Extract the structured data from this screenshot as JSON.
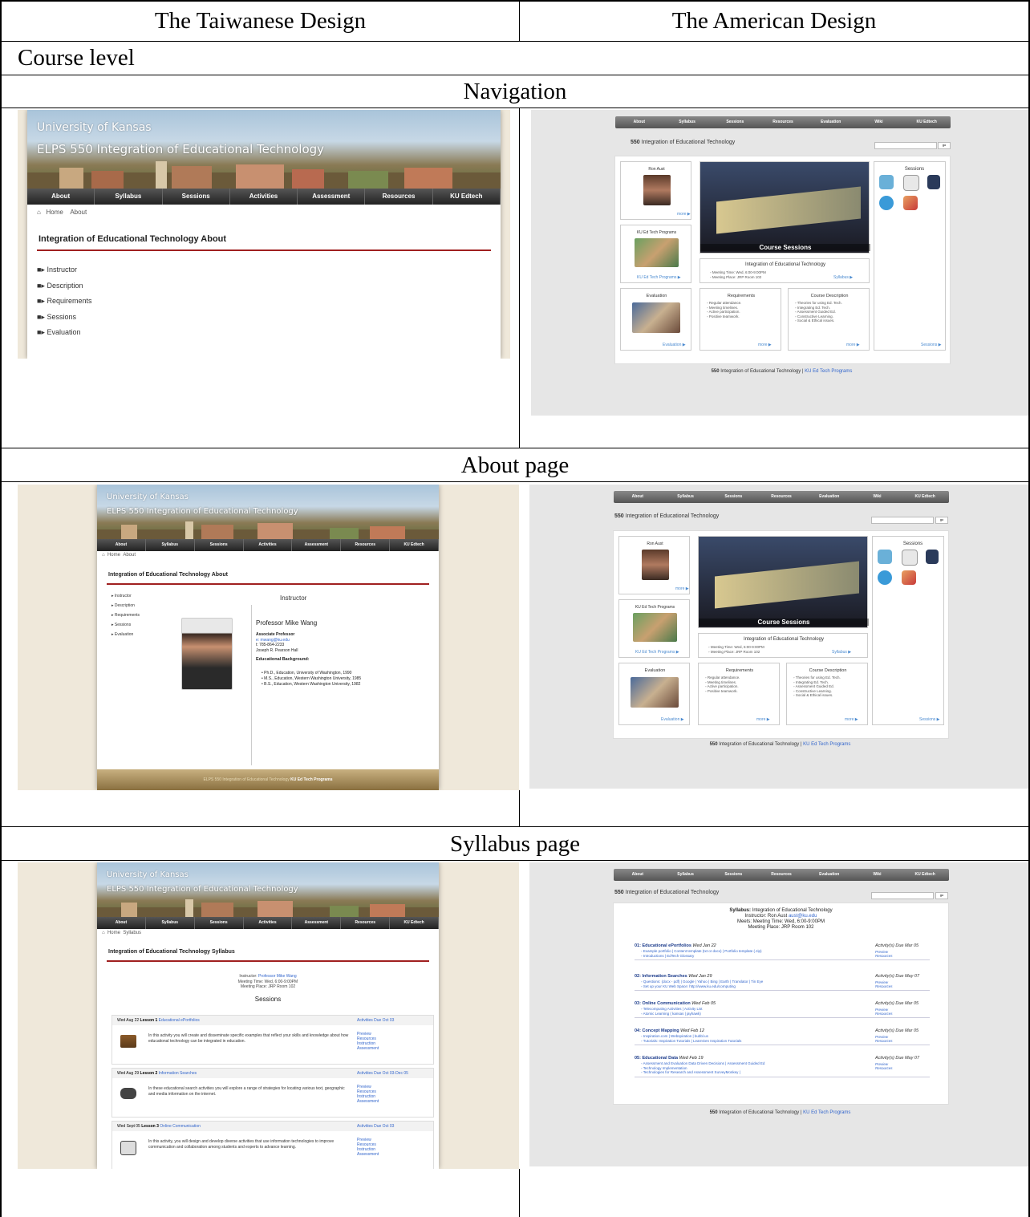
{
  "table": {
    "header_left": "The Taiwanese Design",
    "header_right": "The American Design",
    "course_level": "Course level",
    "sections": [
      "Navigation",
      "About page",
      "Syllabus page"
    ]
  },
  "taiwan": {
    "university": "University of Kansas",
    "course": "ELPS 550 Integration of Educational Technology",
    "nav": [
      "About",
      "Syllabus",
      "Sessions",
      "Activities",
      "Assessment",
      "Resources",
      "KU Edtech"
    ],
    "crumb_home": "Home",
    "crumb_about": "About",
    "crumb_syllabus": "Syllabus",
    "about_heading": "Integration of Educational Technology About",
    "syllabus_heading": "Integration of Educational Technology Syllabus",
    "side_items": [
      "Instructor",
      "Description",
      "Requirements",
      "Sessions",
      "Evaluation"
    ],
    "about": {
      "instructor_title": "Instructor",
      "name": "Professor Mike Wang",
      "role": "Associate Professor",
      "email": "e: mwang@ku.edu",
      "phone": "t: 785-864-2233",
      "office": "Joseph R. Pearson Hall",
      "bg_title": "Educational Background:",
      "degrees": [
        "Ph.D., Education, University of Washington, 1990",
        "M.S., Education, Western Washington University, 1985",
        "B.S., Education, Western Washington University, 1982"
      ],
      "footer": "ELPS 550 Integration of Educational Technology",
      "footer_link": "KU Ed Tech Programs"
    },
    "syllabus": {
      "instructor": "Instructor: Professor Mike Wang",
      "time": "Meeting Time: Wed, 6:00-9:00PM",
      "place": "Meeting Place: JRP Room 102",
      "sessions_title": "Sessions",
      "lessons": [
        {
          "date": "Wed Aug 22",
          "lesson": "Lesson 1",
          "topic": "Educational ePortfolios",
          "due": "Activities Due Oct 03",
          "text": "In this activity you will create and disseminate specific examples that reflect your skills and knowledge about how educational technology can be integrated in education."
        },
        {
          "date": "Wed Aug 29",
          "lesson": "Lesson 2",
          "topic": "Information Searches",
          "due": "Activities Due Oct 03-Dec 05",
          "text": "In these educational search activities you will explore a range of strategies for locating various text, geographic and media information on the internet."
        },
        {
          "date": "Wed Sept 05",
          "lesson": "Lesson 3",
          "topic": "Online Communication",
          "due": "Activities Due Oct 03",
          "text": "In this activity, you will design and develop diverse activities that use information technologies to improve communication and collaboration among students and experts to advance learning."
        }
      ],
      "links": [
        "Preview",
        "Resources",
        "Instruction",
        "Assessment"
      ]
    }
  },
  "america": {
    "nav": [
      "About",
      "Syllabus",
      "Sessions",
      "Resources",
      "Evaluation",
      "Wiki",
      "KU Edtech"
    ],
    "title_num": "550",
    "title_text": "Integration of Educational Technology",
    "go": "go",
    "instructor": "Ron Aust",
    "more": "more ▶",
    "programs_title": "KU Ed Tech Programs",
    "programs_link": "KU Ed Tech Programs ▶",
    "banner_caption": "Course Sessions",
    "sessions_title": "Sessions",
    "info_title": "Integration of Educational Technology",
    "info_items": [
      "Meeting Time: Wed, 6:00-9:00PM",
      "Meeting Place: JRP Room 102"
    ],
    "syllabus_link": "Syllabus ▶",
    "evaluation_title": "Evaluation",
    "evaluation_link": "Evaluation ▶",
    "requirements_title": "Requirements",
    "requirements": [
      "Regular attendance.",
      "Meeting timelines.",
      "Active participation.",
      "Positive teamwork."
    ],
    "description_title": "Course Description",
    "description": [
      "Theories for using Ed. Tech.",
      "Integrating Ed. Tech.",
      "Assessment Guided Ed.",
      "Constructive Learning.",
      "Social & Ethical issues."
    ],
    "sessions_link": "Sessions ▶",
    "footer_num": "550",
    "footer_text": "Integration of Educational Technology |",
    "footer_link": "KU Ed Tech Programs",
    "syllabus": {
      "line1_bold": "Syllabus:",
      "line1": "Integration of Educational Technology",
      "line2": "Instructor: Ron Aust aust@ku.edu",
      "line3": "Meets: Meeting Time: Wed, 6:00-9:00PM",
      "line4": "Meeting Place: JRP Room 102",
      "sessions": [
        {
          "title": "01: Educational ePortfolios",
          "date": "Wed Jan 22",
          "due": "Activity(s) Due Mar 05",
          "items": [
            "Example portfolio | Content template (txt or docx) | Portfolio template (.zip)",
            "Introductions | EdTech Glossary"
          ]
        },
        {
          "title": "02: Information Searches",
          "date": "Wed Jan 29",
          "due": "Activity(s) Due May 07",
          "items": [
            "Questions: (docx - pdf) | Google | Yahoo | Bing | Earth | Translator | Tin Eye",
            "Set up your KU Web Space: http://www.ku.edu/computing"
          ]
        },
        {
          "title": "03: Online Communication",
          "date": "Wed Feb 05",
          "due": "Activity(s) Due Mar 05",
          "items": [
            "Telecomputing Activities | Activity List",
            "Atomic Learning ( kansas | jayhawk)"
          ]
        },
        {
          "title": "04: Concept Mapping",
          "date": "Wed Feb 12",
          "due": "Activity(s) Due Mar 05",
          "items": [
            "Inspiration.com | Webspiration | bubbl.us",
            "Tutorials: Inspiration Tutorials | LearnGen Inspiration Tutorials"
          ]
        },
        {
          "title": "05: Educational Data",
          "date": "Wed Feb 19",
          "due": "Activity(s) Due May 07",
          "items": [
            "Assessment and Evaluation Data Driven Decisions | Assessment Guided Ed",
            "Technology Implementation",
            "Technologies for Research and Assessment SurveyMonkey |"
          ]
        }
      ],
      "preview": "Preview",
      "resources": "Resources"
    }
  }
}
